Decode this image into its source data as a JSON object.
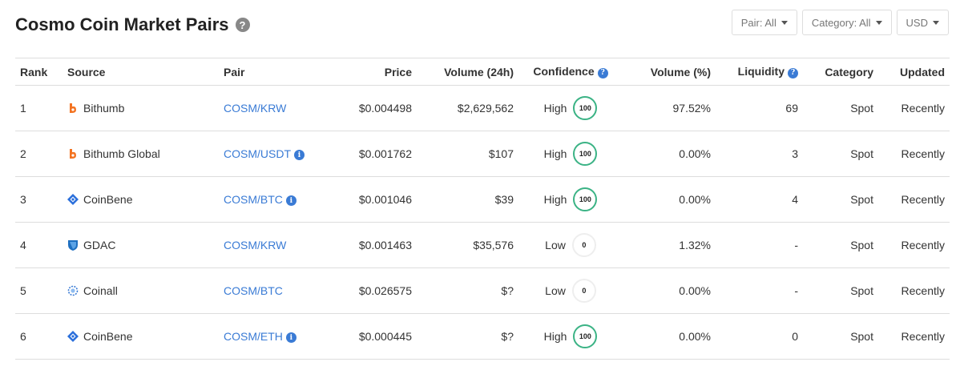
{
  "header": {
    "title": "Cosmo Coin Market Pairs",
    "help_icon": "question-circle-icon"
  },
  "filters": {
    "pair": "Pair: All",
    "category": "Category: All",
    "currency": "USD"
  },
  "colors": {
    "link": "#3a7bd5",
    "high_ring": "#3bb385",
    "low_ring": "#eeeeee",
    "bithumb": "#f37321",
    "coinbene": "#2a6fdb",
    "gdac": "#1e6fc0"
  },
  "columns": {
    "rank": "Rank",
    "source": "Source",
    "pair": "Pair",
    "price": "Price",
    "volume24h": "Volume (24h)",
    "confidence": "Confidence",
    "volume_pct": "Volume (%)",
    "liquidity": "Liquidity",
    "category": "Category",
    "updated": "Updated"
  },
  "rows": [
    {
      "rank": "1",
      "source": "Bithumb",
      "icon": "bithumb-icon",
      "pair": "COSM/KRW",
      "pair_info": false,
      "price": "$0.004498",
      "volume": "$2,629,562",
      "confidence": "High",
      "score": "100",
      "volume_pct": "97.52%",
      "liquidity": "69",
      "category": "Spot",
      "updated": "Recently"
    },
    {
      "rank": "2",
      "source": "Bithumb Global",
      "icon": "bithumb-icon",
      "pair": "COSM/USDT",
      "pair_info": true,
      "price": "$0.001762",
      "volume": "$107",
      "confidence": "High",
      "score": "100",
      "volume_pct": "0.00%",
      "liquidity": "3",
      "category": "Spot",
      "updated": "Recently"
    },
    {
      "rank": "3",
      "source": "CoinBene",
      "icon": "coinbene-icon",
      "pair": "COSM/BTC",
      "pair_info": true,
      "price": "$0.001046",
      "volume": "$39",
      "confidence": "High",
      "score": "100",
      "volume_pct": "0.00%",
      "liquidity": "4",
      "category": "Spot",
      "updated": "Recently"
    },
    {
      "rank": "4",
      "source": "GDAC",
      "icon": "gdac-icon",
      "pair": "COSM/KRW",
      "pair_info": false,
      "price": "$0.001463",
      "volume": "$35,576",
      "confidence": "Low",
      "score": "0",
      "volume_pct": "1.32%",
      "liquidity": "-",
      "category": "Spot",
      "updated": "Recently"
    },
    {
      "rank": "5",
      "source": "Coinall",
      "icon": "coinall-icon",
      "pair": "COSM/BTC",
      "pair_info": false,
      "price": "$0.026575",
      "volume": "$?",
      "confidence": "Low",
      "score": "0",
      "volume_pct": "0.00%",
      "liquidity": "-",
      "category": "Spot",
      "updated": "Recently"
    },
    {
      "rank": "6",
      "source": "CoinBene",
      "icon": "coinbene-icon",
      "pair": "COSM/ETH",
      "pair_info": true,
      "price": "$0.000445",
      "volume": "$?",
      "confidence": "High",
      "score": "100",
      "volume_pct": "0.00%",
      "liquidity": "0",
      "category": "Spot",
      "updated": "Recently"
    }
  ]
}
